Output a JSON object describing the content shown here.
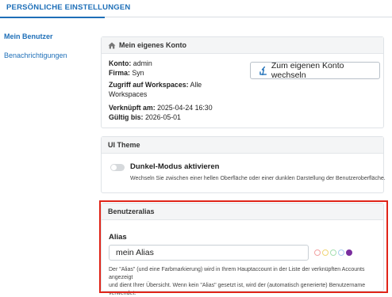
{
  "top_tab": {
    "label": "PERSÖNLICHE EINSTELLUNGEN"
  },
  "sidebar": {
    "items": [
      {
        "label": "Mein Benutzer",
        "active": true
      },
      {
        "label": "Benachrichtigungen",
        "active": false
      }
    ]
  },
  "account_card": {
    "title": "Mein eigenes Konto",
    "icon": "home-icon",
    "konto_label": "Konto:",
    "konto_value": "admin",
    "firma_label": "Firma:",
    "firma_value": "Syn",
    "workspaces_label": "Zugriff auf Workspaces:",
    "workspaces_value_1": "Alle",
    "workspaces_value_2": "Workspaces",
    "linked_label": "Verknüpft am:",
    "linked_value": "2025-04-24 16:30",
    "valid_label": "Gültig bis:",
    "valid_value": "2026-05-01",
    "switch_button": "Zum eigenen Konto wechseln",
    "switch_icon": "switch-account-icon"
  },
  "theme_card": {
    "title": "UI Theme",
    "dark_mode_label": "Dunkel-Modus aktivieren",
    "dark_mode_enabled": false,
    "dark_mode_desc": "Wechseln Sie zwischen einer hellen Oberfläche oder einer dunklen Darstellung der Benutzeroberfläche."
  },
  "alias_card": {
    "title": "Benutzeralias",
    "alias_label": "Alias",
    "alias_value": "mein Alias",
    "color_swatches": [
      {
        "name": "red",
        "color": "#f2a3a3",
        "selected": false
      },
      {
        "name": "yellow",
        "color": "#f0d676",
        "selected": false
      },
      {
        "name": "green",
        "color": "#a6dfb2",
        "selected": false
      },
      {
        "name": "blue",
        "color": "#a9cdf0",
        "selected": false
      },
      {
        "name": "purple",
        "color": "#7a2e9e",
        "selected": true
      }
    ],
    "description_1": "Der \"Alias\" (und eine Farbmarkierung) wird in Ihrem Hauptaccount in der Liste der verknüpften Accounts angezeigt",
    "description_2": "und dient Ihrer Übersicht. Wenn kein \"Alias\" gesetzt ist, wird der (automatisch generierte) Benutzername",
    "description_3": "verwendet."
  },
  "colors": {
    "accent": "#1e6fb8",
    "highlight": "#e02418"
  }
}
